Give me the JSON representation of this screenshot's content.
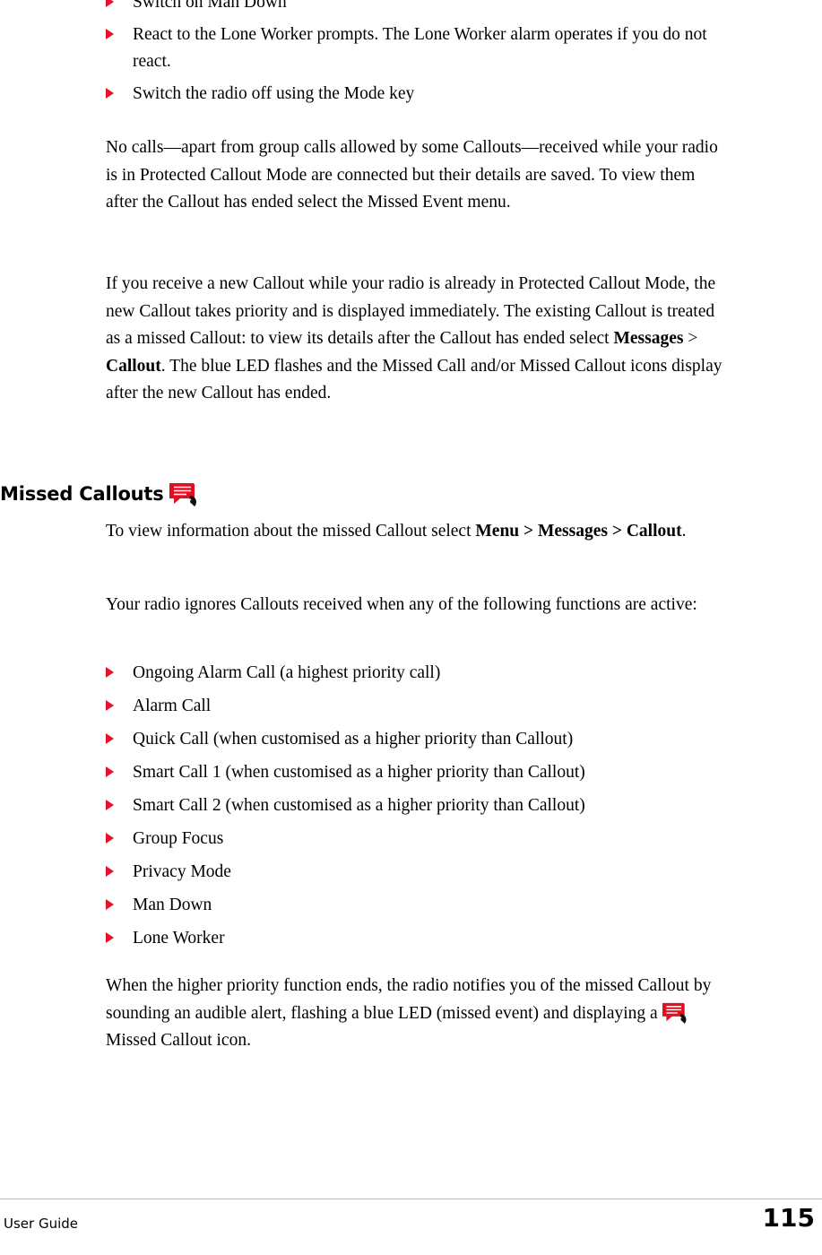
{
  "document": {
    "footer": {
      "left_label": "User Guide",
      "page_number": "115"
    },
    "top_list": {
      "items": [
        "Switch on Man Down",
        "React to the Lone Worker prompts. The Lone Worker alarm operates if you do not react.",
        "Switch the radio off using the Mode key"
      ]
    },
    "paragraph_1": "No calls—apart from group calls allowed by some Callouts—received while your radio is in Protected Callout Mode are connected but their details are saved. To view them after the Callout has ended select the Missed Event menu.",
    "paragraph_2": {
      "part_1": "If you receive a new Callout while your radio is already in Protected Callout Mode, the new Callout takes priority and is displayed immediately. The existing Callout is treated as a missed Callout: to view its details after the Callout has ended select ",
      "bold_1": "Messages",
      "part_2": " > ",
      "bold_2": "Callout",
      "part_3": ". The blue LED flashes and the Missed Call and/or Missed Callout icons display after the new Callout has ended."
    },
    "section_heading": {
      "title": "Missed Callouts",
      "icon": "missed-callout-icon"
    },
    "paragraph_3": {
      "part_1": "To view information about the missed Callout select ",
      "bold_1": "Menu > Messages > Callout",
      "part_2": "."
    },
    "paragraph_4": "Your radio ignores Callouts received when any of the following functions are active:",
    "ignore_list": {
      "items": [
        "Ongoing Alarm Call (a highest priority call)",
        "Alarm Call",
        "Quick Call (when customised as a higher priority than Callout)",
        "Smart Call 1 (when customised as a higher priority than Callout)",
        "Smart Call 2 (when customised as a higher priority than Callout)",
        "Group Focus",
        "Privacy Mode",
        "Man Down",
        "Lone Worker"
      ]
    },
    "paragraph_5": {
      "part_1": "When the higher priority function ends, the radio notifies you of the missed Callout by sounding an audible alert, flashing a blue LED (missed event) and displaying a ",
      "part_2": " Missed Callout icon."
    },
    "colors": {
      "bullet_red": "#e8112d",
      "icon_red": "#e01020",
      "rule_grey": "#bdbdbd"
    }
  }
}
